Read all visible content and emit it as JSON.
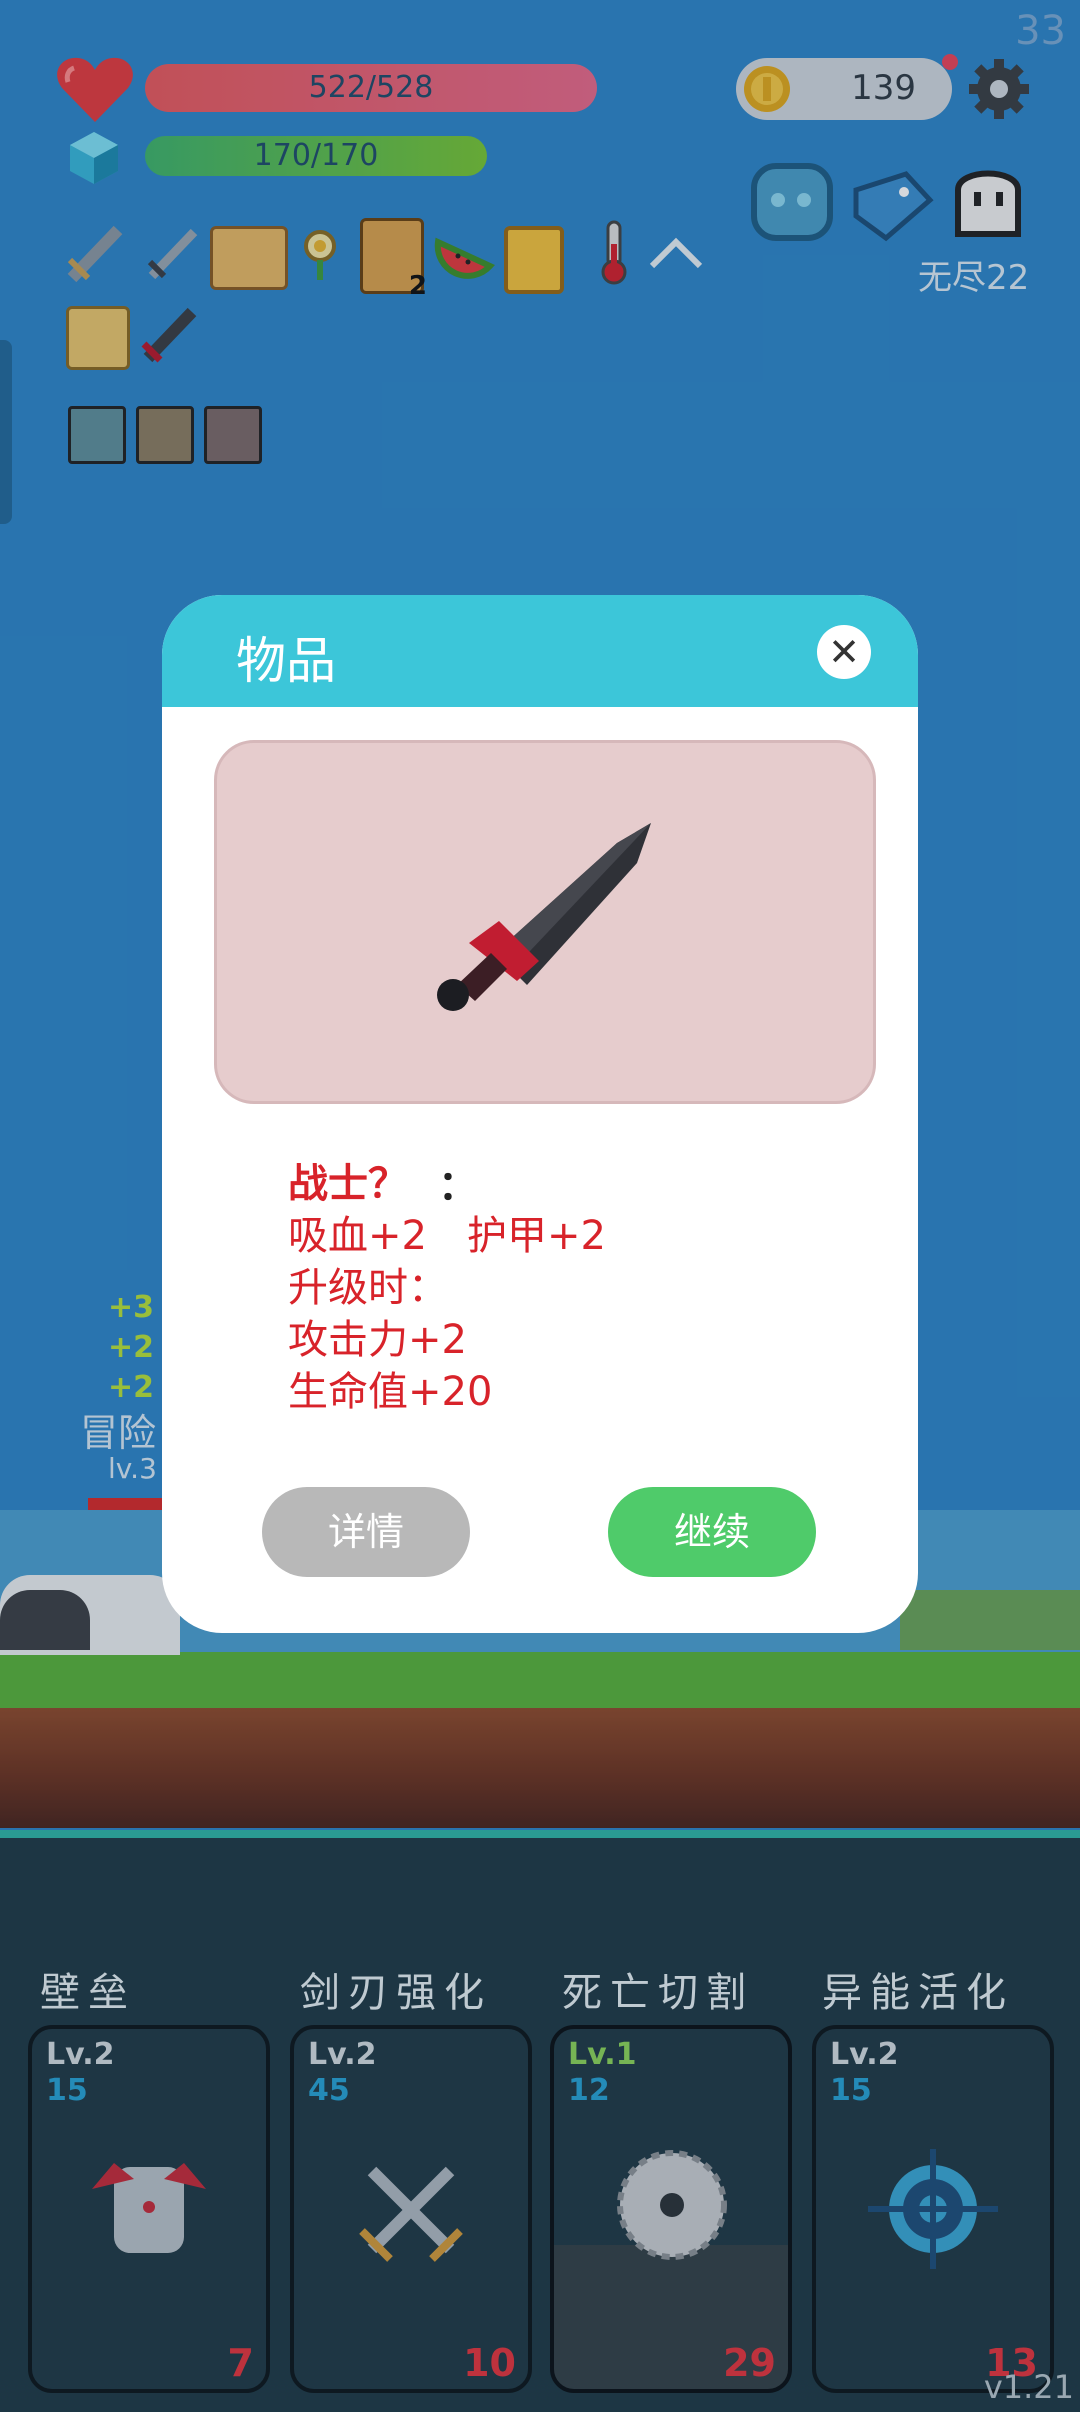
{
  "hud": {
    "fps": "33",
    "hp_text": "522/528",
    "mp_text": "170/170",
    "coins": "139",
    "endless_label": "无尽22"
  },
  "battle": {
    "monster_label": "冒险",
    "monster_level": "lv.3"
  },
  "dialog": {
    "title": "物品",
    "close_label": "✕",
    "item_name": "战士？",
    "colon": "：",
    "line1": "吸血+2　护甲+2",
    "line2": "升级时：",
    "line3": "攻击力+2",
    "line4": "生命值+20",
    "detail_button": "详情",
    "continue_button": "继续"
  },
  "skills": [
    {
      "name": "壁垒",
      "level": "Lv.2",
      "cost": "15",
      "count": "7"
    },
    {
      "name": "剑刃强化",
      "level": "Lv.2",
      "cost": "45",
      "count": "10"
    },
    {
      "name": "死亡切割",
      "level": "Lv.1",
      "cost": "12",
      "count": "29"
    },
    {
      "name": "异能活化",
      "level": "Lv.2",
      "cost": "15",
      "count": "13"
    }
  ],
  "version": "v1.21",
  "colors": {
    "accent": "#3cc6d9",
    "danger_text": "#d8232a",
    "continue": "#4fcb6a"
  }
}
